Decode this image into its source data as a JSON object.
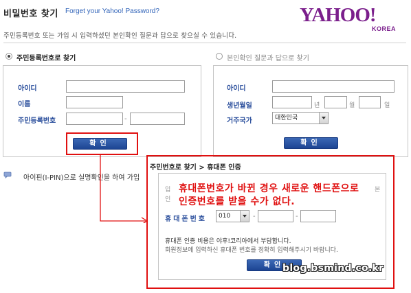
{
  "header": {
    "title": "비밀번호 찾기",
    "subtitle": "Forget your Yahoo! Password?",
    "logo_main": "YAHOO!",
    "logo_sub": "KOREA",
    "intro": "주민등록번호 또는 가입 시 입력하셨던 본인확인 질문과 답으로 찾으실 수 있습니다."
  },
  "left_option": {
    "label": "주민등록번호로 찾기",
    "selected": true,
    "fields": {
      "id_label": "아이디",
      "name_label": "이름",
      "ssn_label": "주민등록번호",
      "dash": "-"
    },
    "confirm_label": "확인"
  },
  "right_option": {
    "label": "본인확인 질문과 답으로 찾기",
    "selected": false,
    "fields": {
      "id_label": "아이디",
      "birth_label": "생년월일",
      "year_unit": "년",
      "month_unit": "월",
      "day_unit": "일",
      "country_label": "거주국가",
      "country_value": "대한민국"
    },
    "confirm_label": "확인"
  },
  "ipin": {
    "text": "아이핀(I-PIN)으로 실명확인을 하여 가입"
  },
  "popup": {
    "title": "주민번호로 찾기 > 휴대폰 인증",
    "desc_left_1": "입",
    "desc_left_2": "인",
    "desc_right_1": "본",
    "desc_right_2": "",
    "annotation_line1": "휴대폰번호가 바뀐 경우 새로운 핸드폰으로",
    "annotation_line2": "인증번호를 받을 수가 없다.",
    "phone_label": "휴대폰번호",
    "phone_prefix": "010",
    "dash": "-",
    "fee_text": "휴대폰 인증 비용은 야후!코리아에서 부담합니다.",
    "notice_text": "회원정보에 입력하신 휴대폰 번호를 정확히 입력해주시기 바랍니다.",
    "confirm_label": "확인"
  },
  "watermark": "blog.bsmind.co.kr",
  "colors": {
    "accent_blue": "#2a4e9c",
    "brand_purple": "#7b1f8c",
    "highlight_red": "#e01010"
  }
}
